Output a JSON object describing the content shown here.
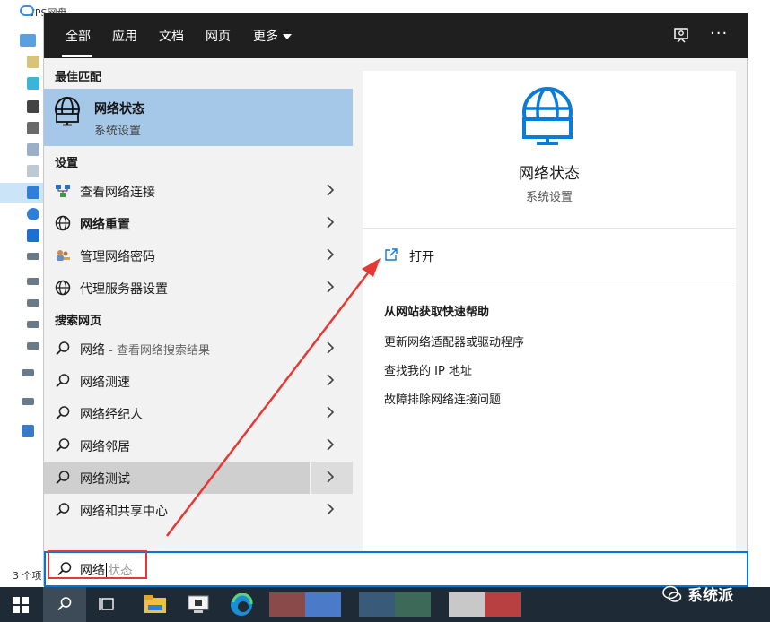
{
  "explorer": {
    "title_partial": "WPS网盘",
    "item_count_partial": "3 个项"
  },
  "tabs": [
    {
      "label": "全部",
      "active": true
    },
    {
      "label": "应用",
      "active": false
    },
    {
      "label": "文档",
      "active": false
    },
    {
      "label": "网页",
      "active": false
    },
    {
      "label": "更多",
      "active": false,
      "dropdown": true
    }
  ],
  "topbar": {
    "more_icon": "···",
    "feedback_icon": "feedback-icon"
  },
  "best_match": {
    "header": "最佳匹配",
    "title": "网络状态",
    "subtitle": "系统设置",
    "icon": "globe-monitor-icon"
  },
  "settings": {
    "header": "设置",
    "items": [
      {
        "label": "查看网络连接",
        "icon": "network-connections-icon"
      },
      {
        "label": "网络重置",
        "icon": "globe-icon"
      },
      {
        "label": "管理网络密码",
        "icon": "users-key-icon"
      },
      {
        "label": "代理服务器设置",
        "icon": "globe-icon"
      }
    ]
  },
  "web": {
    "header": "搜索网页",
    "items": [
      {
        "label": "网络",
        "suffix": " - 查看网络搜索结果"
      },
      {
        "label": "网络测速",
        "suffix": ""
      },
      {
        "label": "网络经纪人",
        "suffix": ""
      },
      {
        "label": "网络邻居",
        "suffix": ""
      },
      {
        "label": "网络测试",
        "suffix": "",
        "highlighted": true
      },
      {
        "label": "网络和共享中心",
        "suffix": ""
      }
    ]
  },
  "detail": {
    "title": "网络状态",
    "subtitle": "系统设置",
    "open_label": "打开",
    "help_title": "从网站获取快速帮助",
    "help_links": [
      "更新网络适配器或驱动程序",
      "查找我的 IP 地址",
      "故障排除网络连接问题"
    ]
  },
  "searchbox": {
    "typed": "网络",
    "hint": "状态"
  },
  "watermark": {
    "text": "系统派"
  },
  "colors": {
    "accent": "#0078d7",
    "best_match_bg": "#a5c8e8",
    "topbar_bg": "#1f1f1f",
    "annotation": "#e53935",
    "taskbar_bg": "#1e2a35"
  }
}
